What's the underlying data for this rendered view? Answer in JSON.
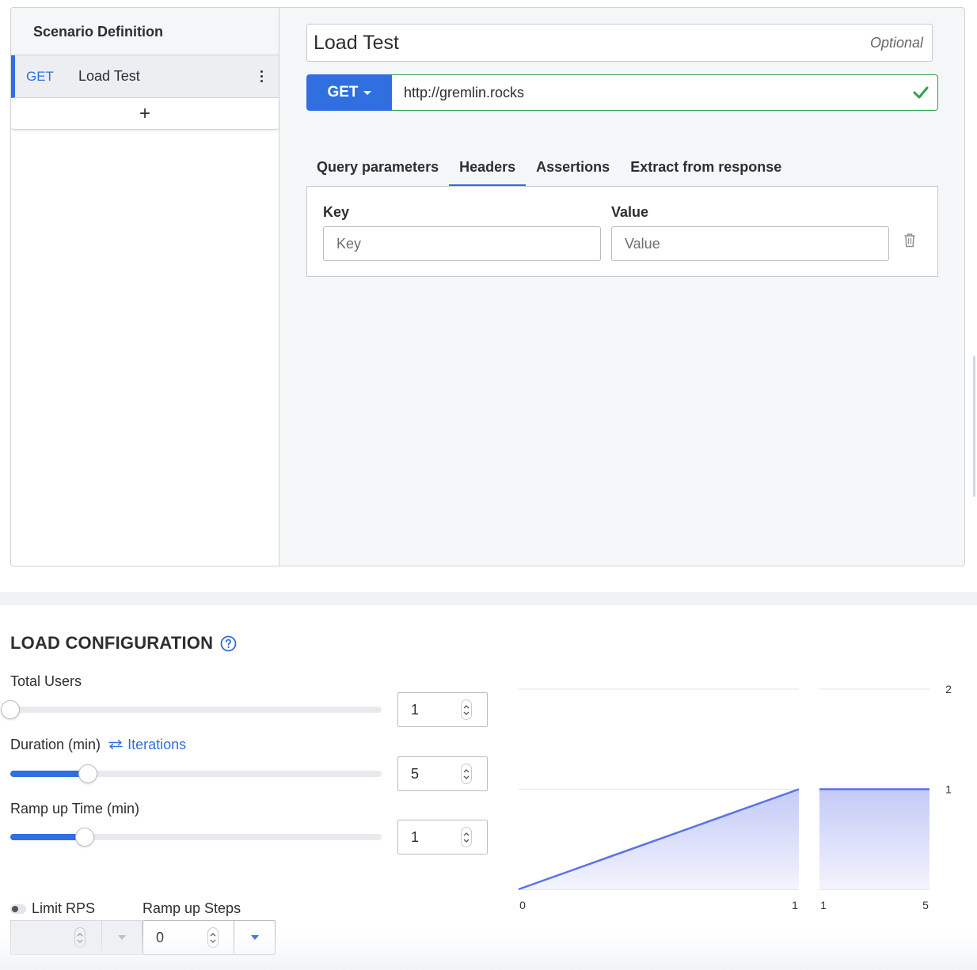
{
  "scenario": {
    "title": "Scenario Definition",
    "requests": [
      {
        "method": "GET",
        "name": "Load Test"
      }
    ],
    "add_label": "+"
  },
  "request": {
    "name": "Load Test",
    "name_hint": "Optional",
    "method": "GET",
    "url": "http://gremlin.rocks",
    "url_valid": true,
    "tabs": [
      "Query parameters",
      "Headers",
      "Assertions",
      "Extract from response"
    ],
    "active_tab": "Headers",
    "headers": {
      "key_label": "Key",
      "value_label": "Value",
      "key_placeholder": "Key",
      "value_placeholder": "Value"
    }
  },
  "load": {
    "title": "LOAD CONFIGURATION",
    "total_users": {
      "label": "Total Users",
      "value": "1",
      "slider_fraction": 0.0
    },
    "duration": {
      "label": "Duration (min)",
      "toggle_label": "Iterations",
      "value": "5",
      "slider_fraction": 0.21
    },
    "ramp_up": {
      "label": "Ramp up Time (min)",
      "value": "1",
      "slider_fraction": 0.2
    },
    "limit_rps": {
      "label": "Limit RPS",
      "enabled": false,
      "value": ""
    },
    "ramp_steps": {
      "label": "Ramp up Steps",
      "value": "0"
    }
  },
  "chart_data": {
    "type": "area",
    "segments": [
      {
        "name": "ramp",
        "x": [
          0,
          1
        ],
        "y": [
          0,
          1
        ],
        "xticks": [
          "0",
          "1"
        ]
      },
      {
        "name": "steady",
        "x": [
          1,
          5
        ],
        "y": [
          1,
          1
        ],
        "xticks": [
          "1",
          "5"
        ]
      }
    ],
    "yticks": [
      "2",
      "1"
    ],
    "ylim": [
      0,
      2
    ],
    "grid": true,
    "colors": {
      "line": "#5b72e8",
      "fill_top": "#c3caf7",
      "fill_bottom": "#f3f4fd",
      "grid": "#e3e5e8"
    }
  },
  "colors": {
    "accent": "#2f6fdf",
    "valid": "#2fa04a"
  }
}
